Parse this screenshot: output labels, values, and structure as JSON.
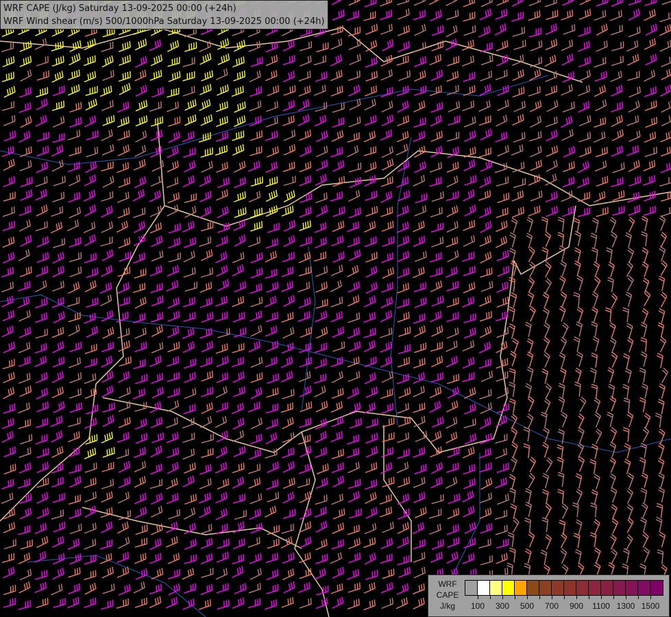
{
  "header": {
    "title_line1": "WRF CAPE (J/kg) Saturday 13-09-2025 00:00 (+24h)",
    "title_line2": "WRF Wind shear (m/s) 500/1000hPa Saturday 13-09-2025 00:00 (+24h)"
  },
  "legend": {
    "label_lines": [
      "WRF",
      "CAPE",
      "J/kg"
    ],
    "colors": [
      "#a0a0a0",
      "#ffffff",
      "#ffff80",
      "#ffff00",
      "#ffa500",
      "#8b4a18",
      "#8b4020",
      "#8d3a26",
      "#8e332c",
      "#8c2c36",
      "#8a263e",
      "#882046",
      "#861a50",
      "#841458",
      "#820c62",
      "#80006a"
    ],
    "tick_labels": [
      "100",
      "300",
      "500",
      "700",
      "900",
      "1100",
      "1300",
      "1500"
    ]
  },
  "map_colors": {
    "shear_high": "#ff00ff",
    "shear_mid": "#f07868",
    "shear_low": "#c07878",
    "shear_very_high": "#ffff00",
    "borders": "#e8c898",
    "rivers": "#2a5cc0"
  }
}
